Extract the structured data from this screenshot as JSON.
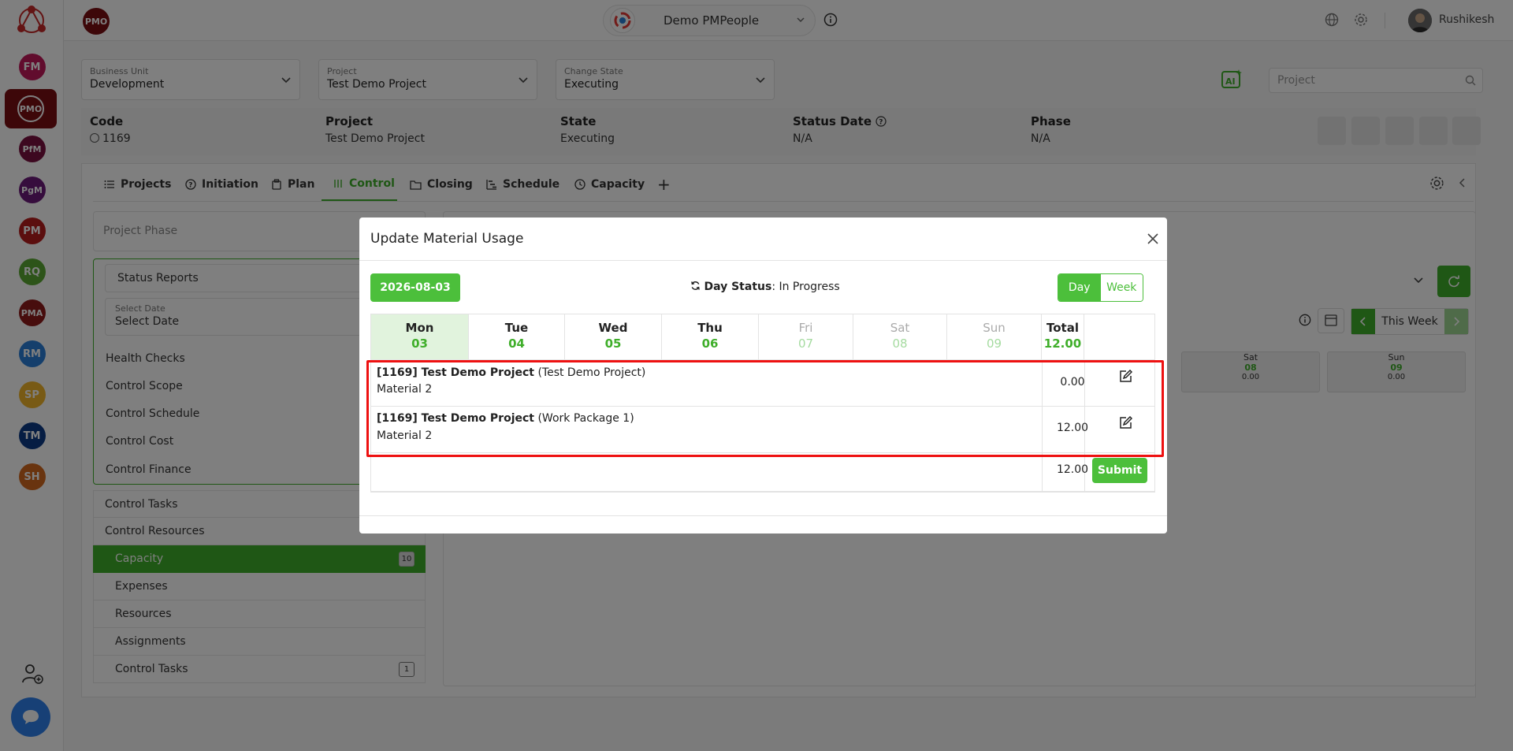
{
  "rail": {
    "items": [
      {
        "label": "FM",
        "color": "#c2185b"
      },
      {
        "label": "PMO",
        "color": "#7a0e12"
      },
      {
        "label": "PfM",
        "color": "#7b1040"
      },
      {
        "label": "PgM",
        "color": "#6d1b7b"
      },
      {
        "label": "PM",
        "color": "#b71c1c"
      },
      {
        "label": "RQ",
        "color": "#5aa832"
      },
      {
        "label": "PMA",
        "color": "#8e1a1a"
      },
      {
        "label": "RM",
        "color": "#2a7fd8"
      },
      {
        "label": "SP",
        "color": "#f0b52b"
      },
      {
        "label": "TM",
        "color": "#0d3b86"
      },
      {
        "label": "SH",
        "color": "#d2691e"
      }
    ]
  },
  "topbar": {
    "pmo_badge": "PMO",
    "tenant": "Demo PMPeople",
    "username": "Rushikesh"
  },
  "selectors": {
    "business_unit": {
      "label": "Business Unit",
      "value": "Development"
    },
    "project": {
      "label": "Project",
      "value": "Test Demo Project"
    },
    "change_state": {
      "label": "Change State",
      "value": "Executing"
    },
    "search_placeholder": "Project"
  },
  "info": {
    "code": {
      "label": "Code",
      "value": "1169"
    },
    "project": {
      "label": "Project",
      "value": "Test Demo Project"
    },
    "state": {
      "label": "State",
      "value": "Executing"
    },
    "status_date": {
      "label": "Status Date",
      "value": "N/A"
    },
    "phase": {
      "label": "Phase",
      "value": "N/A"
    }
  },
  "tabs": [
    "Projects",
    "Initiation",
    "Plan",
    "Control",
    "Closing",
    "Schedule",
    "Capacity"
  ],
  "left_menu": {
    "phase_placeholder": "Project Phase",
    "status_reports": "Status Reports",
    "select_date_label": "Select Date",
    "select_date_value": "Select Date",
    "group_items": [
      "Health Checks",
      "Control Scope",
      "Control Schedule",
      "Control Cost",
      "Control Finance"
    ],
    "control_tasks": "Control Tasks",
    "control_resources": "Control Resources",
    "sub_items": [
      {
        "label": "Capacity",
        "count": "10"
      },
      {
        "label": "Expenses",
        "count": ""
      },
      {
        "label": "Resources",
        "count": ""
      },
      {
        "label": "Assignments",
        "count": ""
      },
      {
        "label": "Control Tasks",
        "count": "1"
      }
    ]
  },
  "background_week": {
    "nav_label": "This Week",
    "cells": [
      {
        "day": "Sat",
        "date": "08",
        "total": "0.00"
      },
      {
        "day": "Sun",
        "date": "09",
        "total": "0.00"
      }
    ]
  },
  "modal": {
    "title": "Update Material Usage",
    "date": "2026-08-03",
    "day_status_label": "Day Status",
    "day_status_value": "In Progress",
    "view_day": "Day",
    "view_week": "Week",
    "days": [
      {
        "name": "Mon",
        "date": "03"
      },
      {
        "name": "Tue",
        "date": "04"
      },
      {
        "name": "Wed",
        "date": "05"
      },
      {
        "name": "Thu",
        "date": "06"
      },
      {
        "name": "Fri",
        "date": "07"
      },
      {
        "name": "Sat",
        "date": "08"
      },
      {
        "name": "Sun",
        "date": "09"
      }
    ],
    "total_label": "Total",
    "total_value": "12.00",
    "rows": [
      {
        "code": "[1169] Test Demo Project",
        "context": "(Test Demo Project)",
        "material": "Material 2",
        "value": "0.00"
      },
      {
        "code": "[1169] Test Demo Project",
        "context": "(Work Package 1)",
        "material": "Material 2",
        "value": "12.00"
      }
    ],
    "footer_total": "12.00",
    "submit_label": "Submit"
  }
}
